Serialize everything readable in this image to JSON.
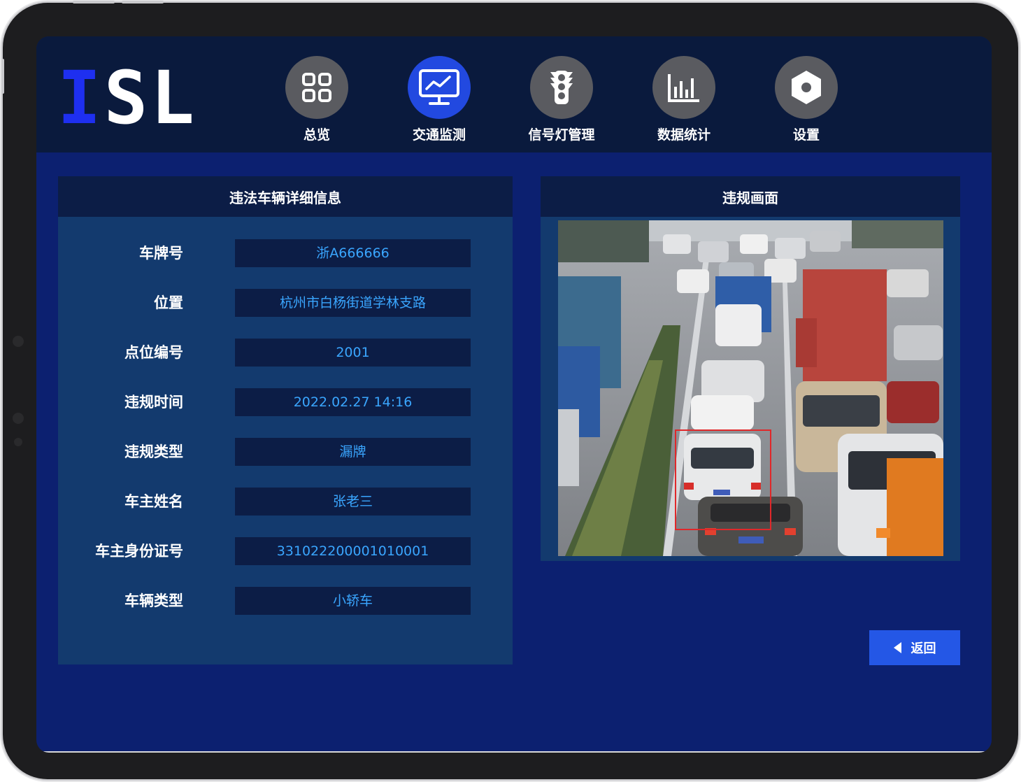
{
  "app": {
    "logo_letter_i": "I",
    "logo_rest": "SL"
  },
  "nav": [
    {
      "label": "总览",
      "icon": "grid-icon",
      "active": false
    },
    {
      "label": "交通监测",
      "icon": "monitor-chart-icon",
      "active": true
    },
    {
      "label": "信号灯管理",
      "icon": "traffic-light-icon",
      "active": false
    },
    {
      "label": "数据统计",
      "icon": "bar-chart-icon",
      "active": false
    },
    {
      "label": "设置",
      "icon": "settings-hexagon-icon",
      "active": false
    }
  ],
  "details": {
    "title": "违法车辆详细信息",
    "fields": [
      {
        "label": "车牌号",
        "value": "浙A666666"
      },
      {
        "label": "位置",
        "value": "杭州市白杨街道学林支路"
      },
      {
        "label": "点位编号",
        "value": "2001"
      },
      {
        "label": "违规时间",
        "value": "2022.02.27 14:16"
      },
      {
        "label": "违规类型",
        "value": "漏牌"
      },
      {
        "label": "车主姓名",
        "value": "张老三"
      },
      {
        "label": "车主身份证号",
        "value": "331022200001010001"
      },
      {
        "label": "车辆类型",
        "value": "小轿车"
      }
    ]
  },
  "violation_view": {
    "title": "违规画面"
  },
  "actions": {
    "back_label": "返回"
  },
  "colors": {
    "screen_bg": "#0c2070",
    "topbar_bg": "#0a1a3d",
    "panel_bg": "#133a6e",
    "panel_header_bg": "#0c1d46",
    "value_text": "#3aa6ff",
    "active_nav": "#2249e0",
    "inactive_nav": "#5a5b60",
    "button_bg": "#2457e6",
    "logo_blue": "#1e2ff0"
  }
}
